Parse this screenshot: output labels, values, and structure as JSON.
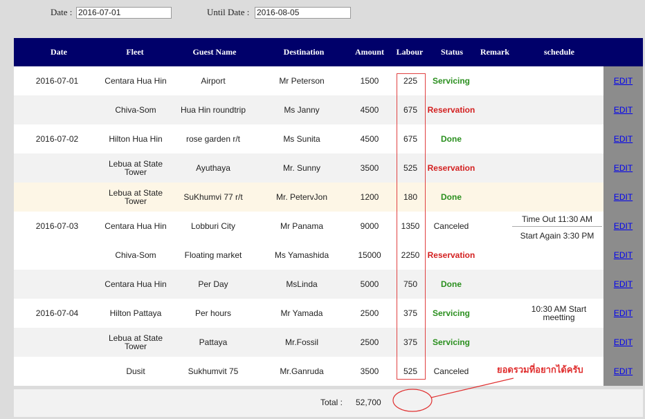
{
  "filters": {
    "date_label": "Date :",
    "date_value": "2016-07-01",
    "until_label": "Until Date :",
    "until_value": "2016-08-05"
  },
  "headers": [
    "Date",
    "Fleet",
    "Guest Name",
    "Destination",
    "Amount",
    "Labour",
    "Status",
    "Remark",
    "schedule"
  ],
  "rows": [
    {
      "date": "2016-07-01",
      "fleet": "Centara Hua Hin",
      "guest": "Airport",
      "dest": "Mr Peterson",
      "amount": "1500",
      "labour": "225",
      "status": "Servicing",
      "remark": "",
      "schedule": "",
      "edit": "EDIT"
    },
    {
      "date": "",
      "fleet": "Chiva-Som",
      "guest": "Hua Hin roundtrip",
      "dest": "Ms Janny",
      "amount": "4500",
      "labour": "675",
      "status": "Reservation",
      "remark": "",
      "schedule": "",
      "edit": "EDIT"
    },
    {
      "date": "2016-07-02",
      "fleet": "Hilton Hua Hin",
      "guest": "rose garden r/t",
      "dest": "Ms Sunita",
      "amount": "4500",
      "labour": "675",
      "status": "Done",
      "remark": "",
      "schedule": "",
      "edit": "EDIT"
    },
    {
      "date": "",
      "fleet": "Lebua at State Tower",
      "guest": "Ayuthaya",
      "dest": "Mr. Sunny",
      "amount": "3500",
      "labour": "525",
      "status": "Reservation",
      "remark": "",
      "schedule": "",
      "edit": "EDIT"
    },
    {
      "date": "",
      "fleet": "Lebua at State Tower",
      "guest": "SuKhumvi 77 r/t",
      "dest": "Mr. PetervJon",
      "amount": "1200",
      "labour": "180",
      "status": "Done",
      "remark": "",
      "schedule": "",
      "edit": "EDIT"
    },
    {
      "date": "2016-07-03",
      "fleet": "Centara Hua Hin",
      "guest": "Lobburi City",
      "dest": "Mr Panama",
      "amount": "9000",
      "labour": "1350",
      "status": "Canceled",
      "remark": "",
      "schedule": "Time Out 11:30 AM",
      "schedule2": "Start Again 3:30 PM",
      "edit": "EDIT"
    },
    {
      "date": "",
      "fleet": "Chiva-Som",
      "guest": "Floating market",
      "dest": "Ms Yamashida",
      "amount": "15000",
      "labour": "2250",
      "status": "Reservation",
      "remark": "",
      "schedule": "",
      "edit": "EDIT"
    },
    {
      "date": "",
      "fleet": "Centara Hua Hin",
      "guest": "Per Day",
      "dest": "MsLinda",
      "amount": "5000",
      "labour": "750",
      "status": "Done",
      "remark": "",
      "schedule": "",
      "edit": "EDIT"
    },
    {
      "date": "2016-07-04",
      "fleet": "Hilton Pattaya",
      "guest": "Per hours",
      "dest": "Mr Yamada",
      "amount": "2500",
      "labour": "375",
      "status": "Servicing",
      "remark": "",
      "schedule": "10:30 AM Start meetting",
      "edit": "EDIT"
    },
    {
      "date": "",
      "fleet": "Lebua at State Tower",
      "guest": "Pattaya",
      "dest": "Mr.Fossil",
      "amount": "2500",
      "labour": "375",
      "status": "Servicing",
      "remark": "",
      "schedule": "",
      "edit": "EDIT"
    },
    {
      "date": "",
      "fleet": "Dusit",
      "guest": "Sukhumvit 75",
      "dest": "Mr.Ganruda",
      "amount": "3500",
      "labour": "525",
      "status": "Canceled",
      "remark": "",
      "schedule": "",
      "edit": "EDIT"
    }
  ],
  "total": {
    "label": "Total :",
    "value": "52,700"
  },
  "annotation": {
    "text": "ยอดรวมที่อยากได้ครับ",
    "color": "#e03030"
  }
}
